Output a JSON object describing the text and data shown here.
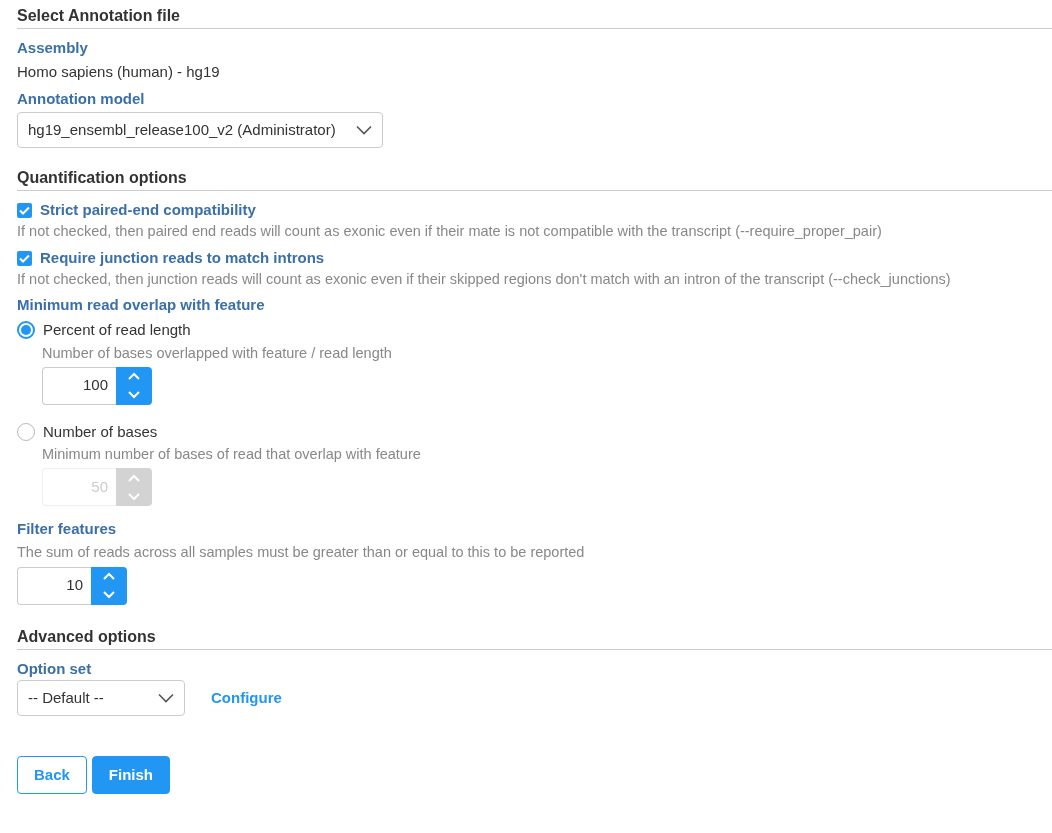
{
  "annotation": {
    "title": "Select Annotation file",
    "assembly_label": "Assembly",
    "assembly_value": "Homo sapiens (human) - hg19",
    "model_label": "Annotation model",
    "model_value": "hg19_ensembl_release100_v2 (Administrator)"
  },
  "quantification": {
    "title": "Quantification options",
    "checkboxes": [
      {
        "label": "Strict paired-end compatibility",
        "description": "If not checked, then paired end reads will count as exonic even if their mate is not compatible with the transcript (--require_proper_pair)",
        "checked": true
      },
      {
        "label": "Require junction reads to match introns",
        "description": "If not checked, then junction reads will count as exonic even if their skipped regions don't match with an intron of the transcript (--check_junctions)",
        "checked": true
      }
    ],
    "overlap": {
      "label": "Minimum read overlap with feature",
      "options": [
        {
          "label": "Percent of read length",
          "description": "Number of bases overlapped with feature / read length",
          "value": "100",
          "selected": true
        },
        {
          "label": "Number of bases",
          "description": "Minimum number of bases of read that overlap with feature",
          "value": "50",
          "selected": false
        }
      ]
    },
    "filter": {
      "label": "Filter features",
      "description": "The sum of reads across all samples must be greater than or equal to this to be reported",
      "value": "10"
    }
  },
  "advanced": {
    "title": "Advanced options",
    "option_set_label": "Option set",
    "option_set_value": "-- Default --",
    "configure_link": "Configure"
  },
  "buttons": [
    {
      "label": "Back",
      "kind": "secondary"
    },
    {
      "label": "Finish",
      "kind": "primary"
    }
  ]
}
